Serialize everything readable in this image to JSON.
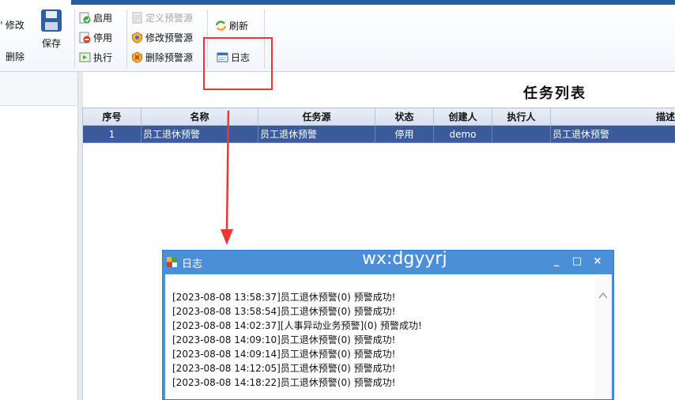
{
  "ribbon": {
    "modify_label": "修改",
    "delete_label": "删除",
    "save_label": "保存",
    "enable_label": "启用",
    "disable_label": "停用",
    "execute_label": "执行",
    "define_source_label": "定义预警源",
    "modify_source_label": "修改预警源",
    "delete_source_label": "删除预警源",
    "refresh_label": "刷新",
    "log_label": "日志"
  },
  "task_list": {
    "title": "任务列表",
    "columns": [
      "序号",
      "名称",
      "任务源",
      "状态",
      "创建人",
      "执行人",
      "描述"
    ],
    "rows": [
      {
        "index": "1",
        "name": "员工退休预警",
        "source": "员工退休预警",
        "status": "停用",
        "creator": "demo",
        "executor": "",
        "description": "员工退休预警"
      }
    ]
  },
  "log_dialog": {
    "title": "日志",
    "watermark": "wx:dgyyrj",
    "lines": [
      "[2023-08-08 13:58:37]员工退休预警(0) 预警成功!",
      "[2023-08-08 13:58:54]员工退休预警(0) 预警成功!",
      "[2023-08-08 14:02:37][人事异动业务预警](0) 预警成功!",
      "[2023-08-08 14:09:10]员工退休预警(0) 预警成功!",
      "[2023-08-08 14:09:14]员工退休预警(0) 预警成功!",
      "[2023-08-08 14:12:05]员工退休预警(0) 预警成功!",
      "[2023-08-08 14:18:22]员工退休预警(0) 预警成功!"
    ],
    "minimize_glyph": "_",
    "maximize_glyph": "□",
    "close_glyph": "×"
  },
  "colors": {
    "accent": "#2a5aa8",
    "selected_row": "#3a5a9a",
    "dialog_title": "#4c8fd9",
    "highlight": "#e53935"
  }
}
